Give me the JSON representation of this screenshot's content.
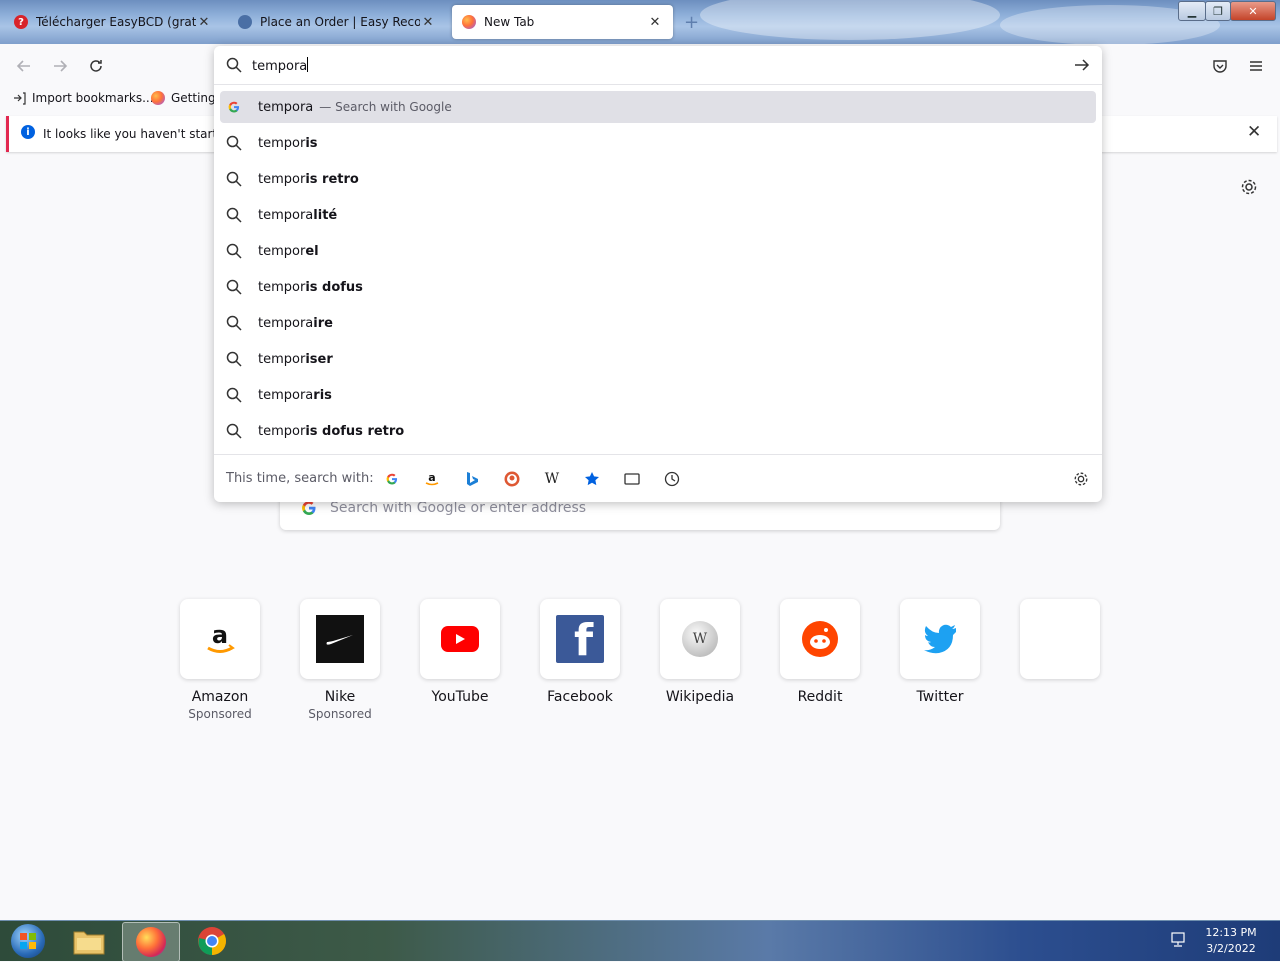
{
  "tabs": [
    {
      "label": "Télécharger EasyBCD (gratuit) - Pr",
      "active": false
    },
    {
      "label": "Place an Order | Easy Recovery Es",
      "active": false
    },
    {
      "label": "New Tab",
      "active": true
    }
  ],
  "new_tab_symbol": "+",
  "window_controls": {
    "minimize": "▁",
    "maximize": "❐",
    "close": "✕"
  },
  "bookmarks": [
    {
      "label": "Import bookmarks...",
      "icon": "import-icon"
    },
    {
      "label": "Getting",
      "icon": "firefox-icon"
    }
  ],
  "notice": {
    "text": "It looks like you haven't started F"
  },
  "urlbar": {
    "value": "tempora",
    "results": [
      {
        "typed": "tempora",
        "bold": "",
        "action": "— Search with Google",
        "icon": "google-icon"
      },
      {
        "typed": "tempor",
        "bold": "is",
        "action": "",
        "icon": "search-icon"
      },
      {
        "typed": "tempor",
        "bold": "is retro",
        "action": "",
        "icon": "search-icon"
      },
      {
        "typed": "tempora",
        "bold": "lité",
        "action": "",
        "icon": "search-icon"
      },
      {
        "typed": "tempor",
        "bold": "el",
        "action": "",
        "icon": "search-icon"
      },
      {
        "typed": "tempor",
        "bold": "is dofus",
        "action": "",
        "icon": "search-icon"
      },
      {
        "typed": "tempora",
        "bold": "ire",
        "action": "",
        "icon": "search-icon"
      },
      {
        "typed": "tempor",
        "bold": "iser",
        "action": "",
        "icon": "search-icon"
      },
      {
        "typed": "tempora",
        "bold": "ris",
        "action": "",
        "icon": "search-icon"
      },
      {
        "typed": "tempor",
        "bold": "is dofus retro",
        "action": "",
        "icon": "search-icon"
      }
    ],
    "one_off_label": "This time, search with:",
    "engines": [
      "google-icon",
      "amazon-icon",
      "bing-icon",
      "duckduckgo-icon",
      "wikipedia-icon",
      "bookmarks-icon",
      "tabs-icon",
      "history-icon"
    ]
  },
  "page": {
    "search_placeholder": "Search with Google or enter address",
    "top_sites": [
      {
        "name": "Amazon",
        "sponsored": "Sponsored",
        "icon": "amazon-logo"
      },
      {
        "name": "Nike",
        "sponsored": "Sponsored",
        "icon": "nike-logo"
      },
      {
        "name": "YouTube",
        "sponsored": "",
        "icon": "youtube-logo"
      },
      {
        "name": "Facebook",
        "sponsored": "",
        "icon": "facebook-logo"
      },
      {
        "name": "Wikipedia",
        "sponsored": "",
        "icon": "wikipedia-logo"
      },
      {
        "name": "Reddit",
        "sponsored": "",
        "icon": "reddit-logo"
      },
      {
        "name": "Twitter",
        "sponsored": "",
        "icon": "twitter-logo"
      },
      {
        "name": "",
        "sponsored": "",
        "icon": "empty"
      }
    ]
  },
  "taskbar": {
    "time": "12:13 PM",
    "date": "3/2/2022"
  },
  "colors": {
    "accent": "#0061e0",
    "selected_row": "#e0e0e6",
    "notice_border": "#e22850"
  }
}
